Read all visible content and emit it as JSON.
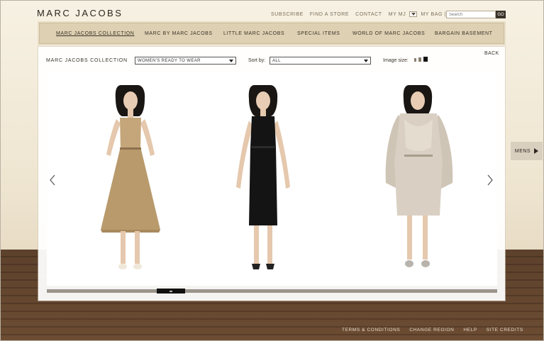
{
  "brand": {
    "logo": "MARC JACOBS"
  },
  "utility_nav": {
    "subscribe": "SUBSCRIBE",
    "find_store": "FIND A STORE",
    "contact": "CONTACT",
    "my_mj": "MY MJ",
    "my_bag": "MY BAG | 0 |",
    "search_placeholder": "Search",
    "go": "GO"
  },
  "main_nav": {
    "items": [
      {
        "label": "MARC JACOBS COLLECTION",
        "active": true
      },
      {
        "label": "MARC BY MARC JACOBS",
        "active": false
      },
      {
        "label": "LITTLE MARC JACOBS",
        "active": false
      },
      {
        "label": "SPECIAL ITEMS",
        "active": false
      },
      {
        "label": "WORLD OF MARC JACOBS",
        "active": false
      },
      {
        "label": "BARGAIN BASEMENT",
        "active": false
      }
    ]
  },
  "panel": {
    "back": "BACK",
    "collection_label": "MARC JACOBS COLLECTION",
    "category_select": "WOMEN'S READY TO WEAR",
    "sort_label": "Sort by:",
    "sort_select": "ALL",
    "image_size_label": "Image size:"
  },
  "products": [
    {
      "id": "look-1",
      "garment": "tan belted sleeveless dress",
      "color": "#b89a6c"
    },
    {
      "id": "look-2",
      "garment": "black sleeveless sheath dress",
      "color": "#141414"
    },
    {
      "id": "look-3",
      "garment": "fur coat",
      "color": "#d9d0c3"
    }
  ],
  "side_tab": {
    "label": "MENS"
  },
  "footer": {
    "links": [
      "TERMS & CONDITIONS",
      "CHANGE REGION",
      "HELP",
      "SITE CREDITS"
    ]
  },
  "colors": {
    "floor": "#6c4c33",
    "nav_bg": "#ddd0b3",
    "panel": "#ffffff"
  }
}
